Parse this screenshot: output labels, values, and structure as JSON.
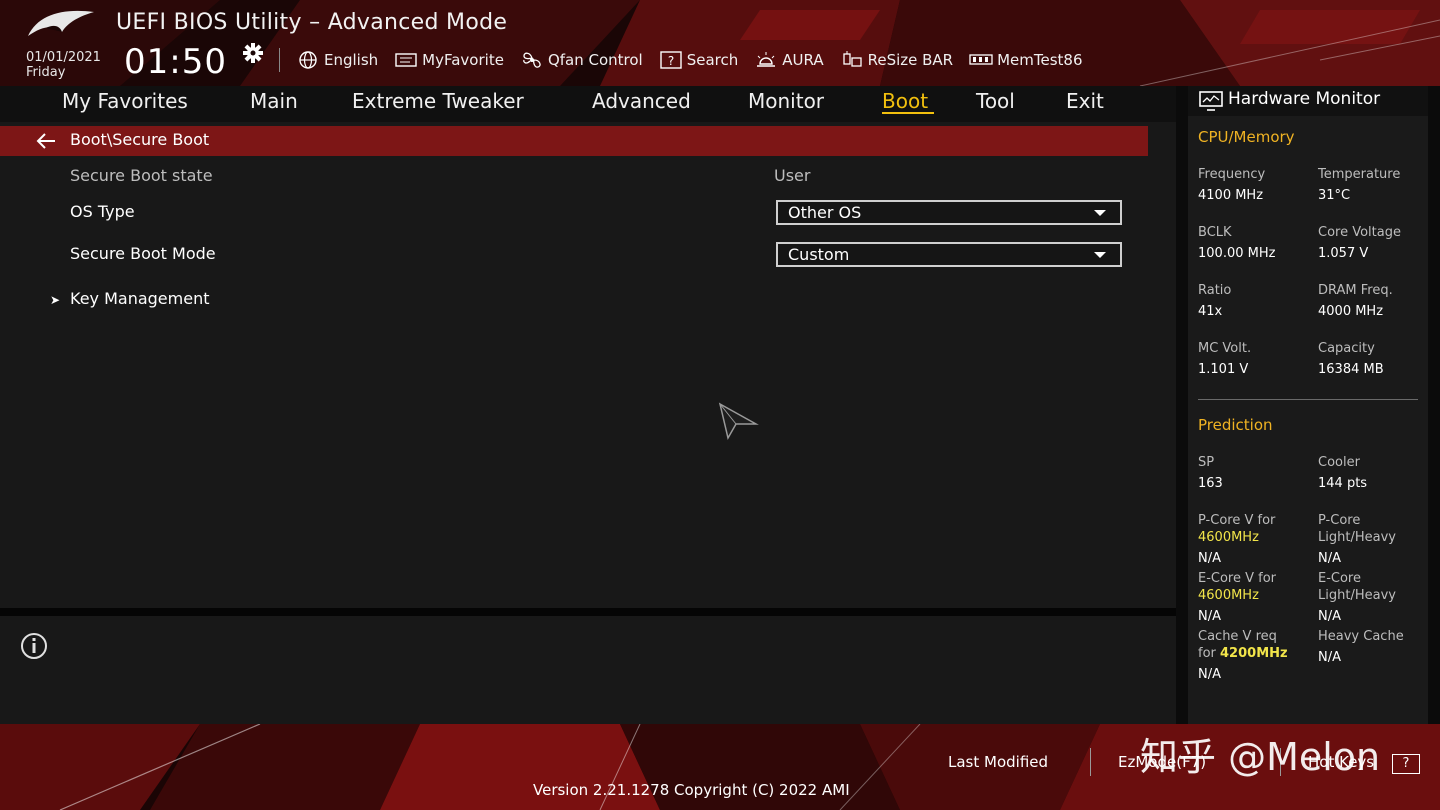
{
  "window": {
    "title": "UEFI BIOS Utility – Advanced Mode"
  },
  "datetime": {
    "date": "01/01/2021",
    "day": "Friday",
    "time": "01:50"
  },
  "toolbar": [
    {
      "label": "English",
      "icon": "globe-icon"
    },
    {
      "label": "MyFavorite",
      "icon": "favorite-icon"
    },
    {
      "label": "Qfan Control",
      "icon": "fan-icon"
    },
    {
      "label": "Search",
      "icon": "search-icon"
    },
    {
      "label": "AURA",
      "icon": "aura-icon"
    },
    {
      "label": "ReSize BAR",
      "icon": "resize-bar-icon"
    },
    {
      "label": "MemTest86",
      "icon": "memtest-icon"
    }
  ],
  "tabs": [
    {
      "label": "My Favorites"
    },
    {
      "label": "Main"
    },
    {
      "label": "Extreme Tweaker"
    },
    {
      "label": "Advanced"
    },
    {
      "label": "Monitor"
    },
    {
      "label": "Boot",
      "active": true
    },
    {
      "label": "Tool"
    },
    {
      "label": "Exit"
    }
  ],
  "breadcrumb": "Boot\\Secure Boot",
  "settings": {
    "secure_boot_state": {
      "label": "Secure Boot state",
      "value": "User"
    },
    "os_type": {
      "label": "OS Type",
      "value": "Other OS"
    },
    "secure_boot_mode": {
      "label": "Secure Boot Mode",
      "value": "Custom"
    },
    "key_management": {
      "label": "Key Management"
    }
  },
  "hw_monitor": {
    "title": "Hardware Monitor",
    "cpu_memory": {
      "title": "CPU/Memory",
      "frequency": {
        "label": "Frequency",
        "value": "4100 MHz"
      },
      "temperature": {
        "label": "Temperature",
        "value": "31°C"
      },
      "bclk": {
        "label": "BCLK",
        "value": "100.00 MHz"
      },
      "core_voltage": {
        "label": "Core Voltage",
        "value": "1.057 V"
      },
      "ratio": {
        "label": "Ratio",
        "value": "41x"
      },
      "dram_freq": {
        "label": "DRAM Freq.",
        "value": "4000 MHz"
      },
      "mc_volt": {
        "label": "MC Volt.",
        "value": "1.101 V"
      },
      "capacity": {
        "label": "Capacity",
        "value": "16384 MB"
      }
    },
    "prediction": {
      "title": "Prediction",
      "sp": {
        "label": "SP",
        "value": "163"
      },
      "cooler": {
        "label": "Cooler",
        "value": "144 pts"
      },
      "pcore_v": {
        "label_line1": "P-Core V for",
        "freq": "4600MHz",
        "value": "N/A"
      },
      "pcore_lh": {
        "label_line1": "P-Core",
        "label_line2": "Light/Heavy",
        "value": "N/A"
      },
      "ecore_v": {
        "label_line1": "E-Core V for",
        "freq": "4600MHz",
        "value": "N/A"
      },
      "ecore_lh": {
        "label_line1": "E-Core",
        "label_line2": "Light/Heavy",
        "value": "N/A"
      },
      "cache_v": {
        "label_line1": "Cache V req",
        "label_prefix": "for ",
        "freq": "4200MHz",
        "value": "N/A"
      },
      "heavy_cache": {
        "label": "Heavy Cache",
        "value": "N/A"
      }
    }
  },
  "footer": {
    "last_modified": "Last Modified",
    "ezmode": "EzMode(F7)",
    "hotkeys": "Hot Keys",
    "hotkeys_key": "?",
    "version": "Version 2.21.1278 Copyright (C) 2022 AMI"
  },
  "watermark": "知乎 @Melon",
  "colors": {
    "accent": "#f2c00e",
    "section": "#f0b323",
    "breadcrumb_bg": "#7d1616",
    "highlight": "#f2e54a"
  }
}
